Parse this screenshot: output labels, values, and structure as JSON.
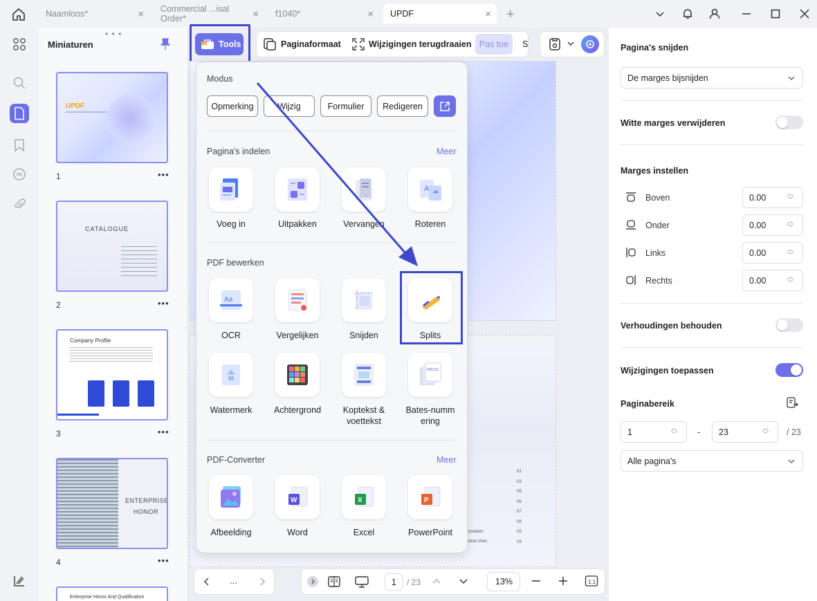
{
  "tabs": [
    {
      "label": "Naamloos*"
    },
    {
      "label": "Commercial ...isal Order*"
    },
    {
      "label": "f1040*"
    },
    {
      "label": "UPDF"
    }
  ],
  "thumbnails": {
    "title": "Miniaturen",
    "pages": [
      {
        "number": "1",
        "brand": "UPDF"
      },
      {
        "number": "2",
        "heading": "CATALOGUE"
      },
      {
        "number": "3",
        "heading": "Company Profile"
      },
      {
        "number": "4",
        "heading": "ENTERPRISE HONOR"
      },
      {
        "number": "",
        "heading": "Enterprise Honor And Qualification"
      }
    ]
  },
  "toolbar": {
    "tools_label": "Tools",
    "page_format_label": "Paginaformaat",
    "revert_label": "Wijzigingen terugdraaien",
    "apply_label": "Pas toe",
    "apply_cut": "S"
  },
  "popup": {
    "mode_title": "Modus",
    "modes": [
      "Opmerking",
      "Wijzig",
      "Formulier",
      "Redigeren"
    ],
    "section1": {
      "title": "Pagina's indelen",
      "more": "Meer",
      "items": [
        "Voeg in",
        "Uitpakken",
        "Vervangen",
        "Roteren"
      ]
    },
    "section2": {
      "title": "PDF bewerken",
      "items": [
        "OCR",
        "Vergelijken",
        "Snijden",
        "Splits",
        "Watermerk",
        "Achtergrond",
        "Koptekst & voettekst",
        "Bates-numm ering"
      ]
    },
    "section3": {
      "title": "PDF-Converter",
      "more": "Meer",
      "items": [
        "Afbeelding",
        "Word",
        "Excel",
        "PowerPoint"
      ]
    }
  },
  "doc_snippets": [
    "01",
    "03",
    "05",
    "06",
    "07",
    "09",
    "15",
    "19",
    "rporation",
    "ctical Uses"
  ],
  "right_panel": {
    "crop_title": "Pagina's snijden",
    "crop_mode": "De marges bijsnijden",
    "white_margins": "Witte marges verwijderen",
    "margins_title": "Marges instellen",
    "margins": [
      {
        "label": "Boven",
        "value": "0.00"
      },
      {
        "label": "Onder",
        "value": "0.00"
      },
      {
        "label": "Links",
        "value": "0.00"
      },
      {
        "label": "Rechts",
        "value": "0.00"
      }
    ],
    "keep_ratio": "Verhoudingen behouden",
    "apply_changes": "Wijzigingen toepassen",
    "range_title": "Paginabereik",
    "range_from": "1",
    "range_sep": "-",
    "range_to": "23",
    "range_total": "/ 23",
    "range_mode": "Alle pagina's"
  },
  "bottom": {
    "dots": "...",
    "page_current": "1",
    "page_total": "/ 23",
    "zoom": "13%"
  },
  "colors": {
    "accent": "#6b6fe8",
    "highlight": "#3f48c9",
    "thumb_border": "#8c90f0"
  }
}
